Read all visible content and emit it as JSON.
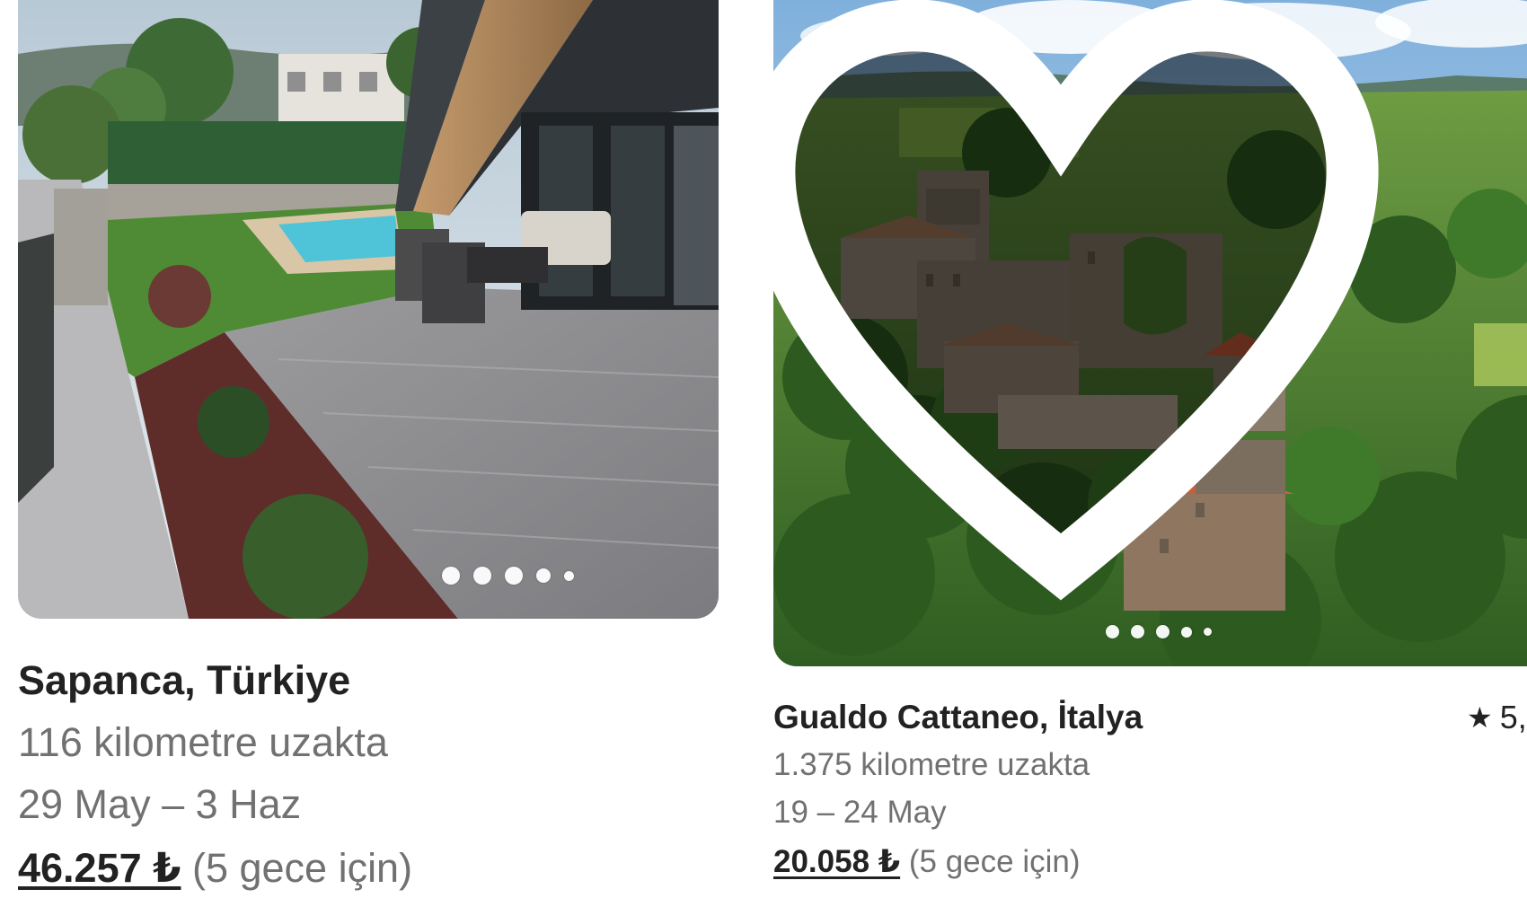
{
  "listings": [
    {
      "location": "Sapanca, Türkiye",
      "distance": "116 kilometre uzakta",
      "dates": "29 May – 3 Haz",
      "price": "46.257 ₺",
      "price_note": "(5 gece için)",
      "photo_count": 5
    },
    {
      "location": "Gualdo Cattaneo, İtalya",
      "distance": "1.375 kilometre uzakta",
      "dates": "19 – 24 May",
      "price": "20.058 ₺",
      "price_note": "(5 gece için)",
      "rating": "5,",
      "photo_count": 5
    }
  ],
  "icons": {
    "rating": "star-icon",
    "favorite": "heart-icon",
    "carousel": "pagination-dot"
  },
  "colors": {
    "text_primary": "#222222",
    "text_secondary": "#717171",
    "dot": "#ffffff"
  }
}
